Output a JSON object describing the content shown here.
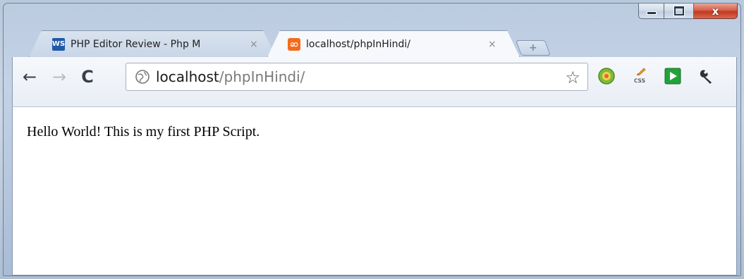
{
  "window": {
    "controls": [
      "minimize",
      "maximize",
      "close"
    ],
    "close_glyph": "x"
  },
  "tabs": [
    {
      "title": "PHP Editor Review - Php M",
      "icon": "webstorm-icon",
      "active": false
    },
    {
      "title": "localhost/phpInHindi/",
      "icon": "xampp-icon",
      "active": true
    }
  ],
  "tab_close_glyph": "×",
  "new_tab_glyph": "+",
  "nav": {
    "back_glyph": "←",
    "forward_glyph": "→",
    "reload_glyph": "C"
  },
  "omnibox": {
    "host": "localhost",
    "path": "/phpInHindi/"
  },
  "extensions": [
    "green-circle-icon",
    "css-edit-icon",
    "green-play-icon",
    "wrench-icon"
  ],
  "extension_css_text": "css",
  "page": {
    "body_text": "Hello World! This is my first PHP Script."
  },
  "colors": {
    "close_button": "#c2381f",
    "xampp_orange": "#f36b1c",
    "link_path_gray": "#7a7a7a"
  }
}
